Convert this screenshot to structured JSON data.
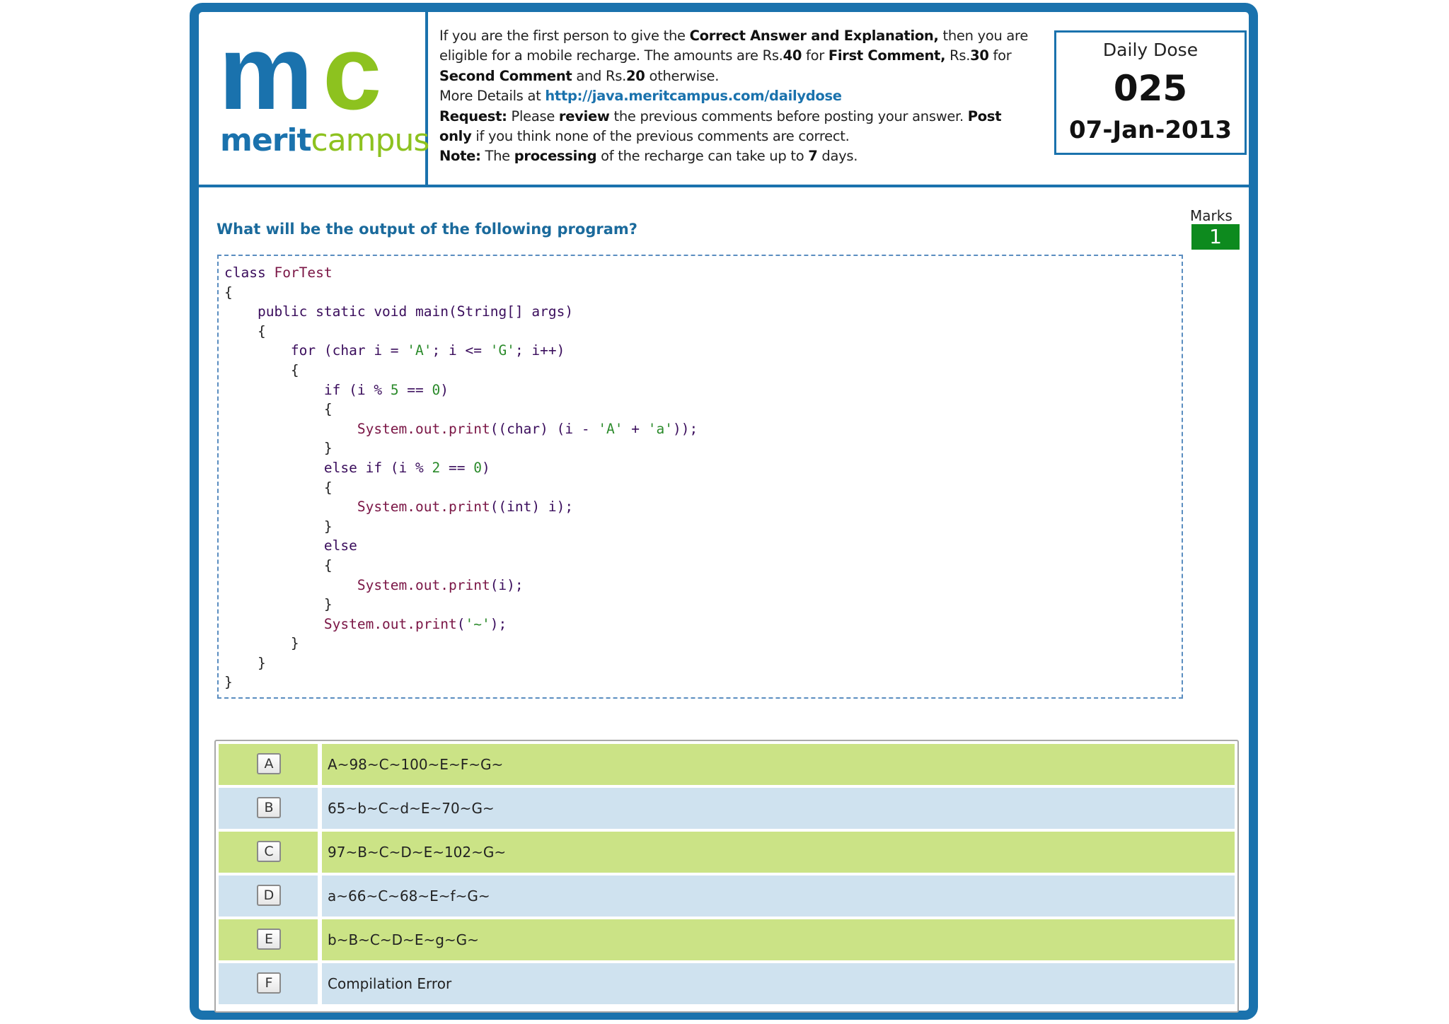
{
  "logo": {
    "mark_m": "m",
    "mark_c": "c",
    "word_merit": "merit",
    "word_campus": "campus"
  },
  "info": {
    "l1a": "If you are the first person to give the ",
    "l1b": "Correct Answer and Explanation,",
    "l1c": " then you are",
    "l2a": "eligible for a mobile recharge. The amounts are Rs.",
    "l2b": "40",
    "l2c": " for ",
    "l2d": "First Comment,",
    "l2e": " Rs.",
    "l2f": "30",
    "l2g": " for",
    "l3a": "Second Comment",
    "l3b": " and Rs.",
    "l3c": "20",
    "l3d": " otherwise.",
    "l4a": "More Details at ",
    "l4b": "http://java.meritcampus.com/dailydose",
    "l5a": "Request:",
    "l5b": " Please ",
    "l5c": "review",
    "l5d": " the previous comments before posting your answer. ",
    "l5e": "Post",
    "l6a": "only",
    "l6b": " if you think none of the previous comments are correct.",
    "l7a": "Note:",
    "l7b": " The ",
    "l7c": "processing",
    "l7d": " of the recharge can take up to ",
    "l7e": "7",
    "l7f": " days."
  },
  "dose": {
    "title": "Daily Dose",
    "number": "025",
    "date": "07-Jan-2013"
  },
  "question": {
    "text": "What will be the output of the following program?",
    "marks_label": "Marks",
    "marks_value": "1"
  },
  "code": {
    "c0a": "class ",
    "c0b": "ForTest",
    "c1": "{",
    "c2a": "    public static void ",
    "c2b": "main",
    "c2c": "(String[] args)",
    "c3": "    {",
    "c4a": "        for (char i = ",
    "c4b": "'A'",
    "c4c": "; i <= ",
    "c4d": "'G'",
    "c4e": "; i++)",
    "c5": "        {",
    "c6a": "            if (i % ",
    "c6b": "5",
    "c6c": " == ",
    "c6d": "0",
    "c6e": ")",
    "c7": "            {",
    "c8a": "                System.out.print",
    "c8b": "((char) (i - ",
    "c8c": "'A'",
    "c8d": " + ",
    "c8e": "'a'",
    "c8f": "));",
    "c9": "            }",
    "c10a": "            else if (i % ",
    "c10b": "2",
    "c10c": " == ",
    "c10d": "0",
    "c10e": ")",
    "c11": "            {",
    "c12a": "                System.out.print",
    "c12b": "((int) i);",
    "c13": "            }",
    "c14": "            else",
    "c15": "            {",
    "c16a": "                System.out.print",
    "c16b": "(i);",
    "c17": "            }",
    "c18a": "            System.out.print",
    "c18b": "(",
    "c18c": "'~'",
    "c18d": ");",
    "c19": "        }",
    "c20": "    }",
    "c21": "}"
  },
  "options": [
    {
      "letter": "A",
      "text": "A~98~C~100~E~F~G~"
    },
    {
      "letter": "B",
      "text": "65~b~C~d~E~70~G~"
    },
    {
      "letter": "C",
      "text": "97~B~C~D~E~102~G~"
    },
    {
      "letter": "D",
      "text": "a~66~C~68~E~f~G~"
    },
    {
      "letter": "E",
      "text": "b~B~C~D~E~g~G~"
    },
    {
      "letter": "F",
      "text": "Compilation Error"
    }
  ],
  "colors": {
    "brand_blue": "#1a72ad",
    "brand_green": "#8dc21f",
    "option_green": "#cbe386",
    "option_blue": "#cfe2ef",
    "marks_green": "#0d8a1e"
  }
}
